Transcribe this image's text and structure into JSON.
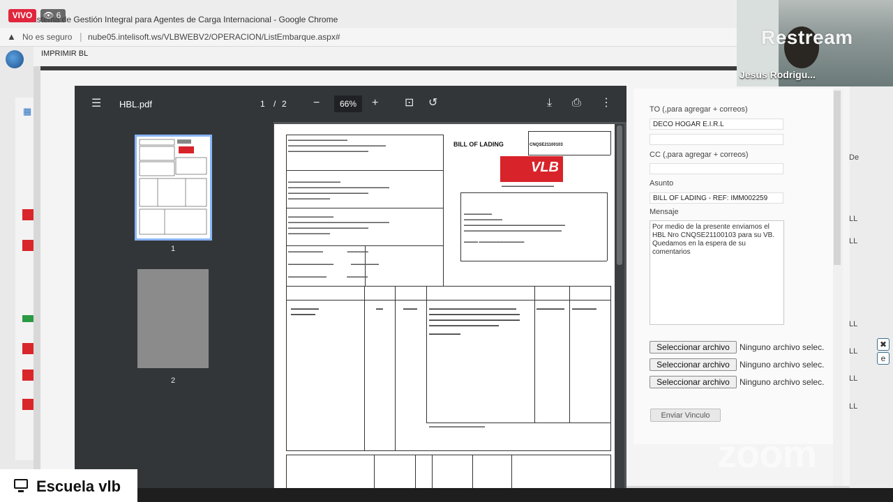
{
  "stream": {
    "live_badge": "VIVO",
    "viewer_count": "6",
    "watermark_brand": "Restream",
    "presenter_name": "Jesus Rodrigu...",
    "conference_logo": "zoom",
    "channel_label": "Escuela vlb"
  },
  "browser": {
    "window_title": "Sistema de Gestión Integral para Agentes de Carga Internacional - Google Chrome",
    "security_label": "No es seguro",
    "url": "nube05.intelisoft.ws/VLBWEBV2/OPERACION/ListEmbarque.aspx#"
  },
  "modal": {
    "title": "IMPRIMIR BL"
  },
  "pdf_viewer": {
    "file_name": "HBL.pdf",
    "current_page": "1",
    "page_separator": "/",
    "total_pages": "2",
    "zoom_level": "66%",
    "thumbnails": [
      {
        "label": "1"
      },
      {
        "label": "2"
      }
    ],
    "document": {
      "title": "BILL OF LADING",
      "bl_number": "CNQSE21100103",
      "logo_text": "VLB"
    }
  },
  "form": {
    "to_label": "TO (,para agregar + correos)",
    "to_value": "DECO HOGAR E.I.R.L",
    "cc_label": "CC (,para agregar + correos)",
    "cc_value": "",
    "subject_label": "Asunto",
    "subject_value": "BILL OF LADING - REF: IMM002259",
    "message_label": "Mensaje",
    "message_value": "Por medio de la presente enviamos el HBL Nro CNQSE21100103 para su VB.\nQuedamos en la espera de su comentarios",
    "file_inputs": [
      {
        "button": "Seleccionar archivo",
        "status": "Ninguno archivo selec."
      },
      {
        "button": "Seleccionar archivo",
        "status": "Ninguno archivo selec."
      },
      {
        "button": "Seleccionar archivo",
        "status": "Ninguno archivo selec."
      }
    ],
    "send_button": "Enviar Vinculo"
  },
  "background_table": {
    "header_fragment": "De",
    "cell_fragments": [
      "LL",
      "LL",
      "LL",
      "LL",
      "LL",
      "LL"
    ]
  },
  "colors": {
    "live_red": "#e0263d",
    "pdf_toolbar": "#323639",
    "pdf_canvas": "#525659",
    "thumb_selected": "#8ab4f8",
    "vlb_red": "#d8232a"
  }
}
